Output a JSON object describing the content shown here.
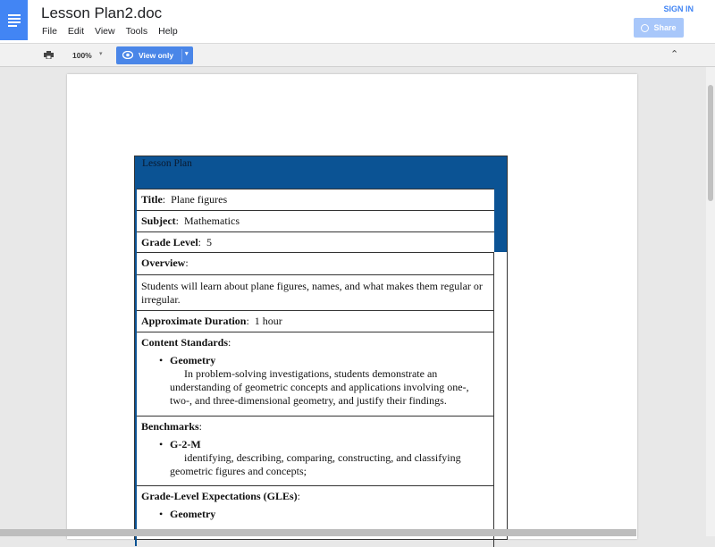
{
  "header": {
    "doc_title": "Lesson Plan2.doc",
    "menu": [
      "File",
      "Edit",
      "View",
      "Tools",
      "Help"
    ],
    "sign_in": "SIGN IN",
    "share": "Share"
  },
  "toolbar": {
    "zoom": "100%",
    "view_mode": "View only"
  },
  "doc": {
    "table_title": "Lesson Plan",
    "title_label": "Title",
    "title_value": "Plane figures",
    "subject_label": "Subject",
    "subject_value": "Mathematics",
    "grade_label": "Grade Level",
    "grade_value": "5",
    "overview_label": "Overview",
    "overview_text": "Students will learn about plane figures, names, and what makes them regular or irregular.",
    "duration_label": "Approximate Duration",
    "duration_value": "1 hour",
    "standards_label": "Content Standards",
    "standards_item": "Geometry",
    "standards_text": "In problem-solving investigations, students demonstrate an understanding of geometric concepts and applications involving one-, two-, and three-dimensional geometry, and justify their findings.",
    "benchmarks_label": "Benchmarks",
    "benchmarks_item": "G-2-M",
    "benchmarks_text": "identifying, describing, comparing, constructing, and classifying geometric figures and concepts;",
    "gle_label": "Grade-Level Expectations (GLEs)",
    "gle_item": "Geometry"
  },
  "colors": {
    "brand_blue": "#4285f4",
    "table_header": "#0b5394"
  }
}
